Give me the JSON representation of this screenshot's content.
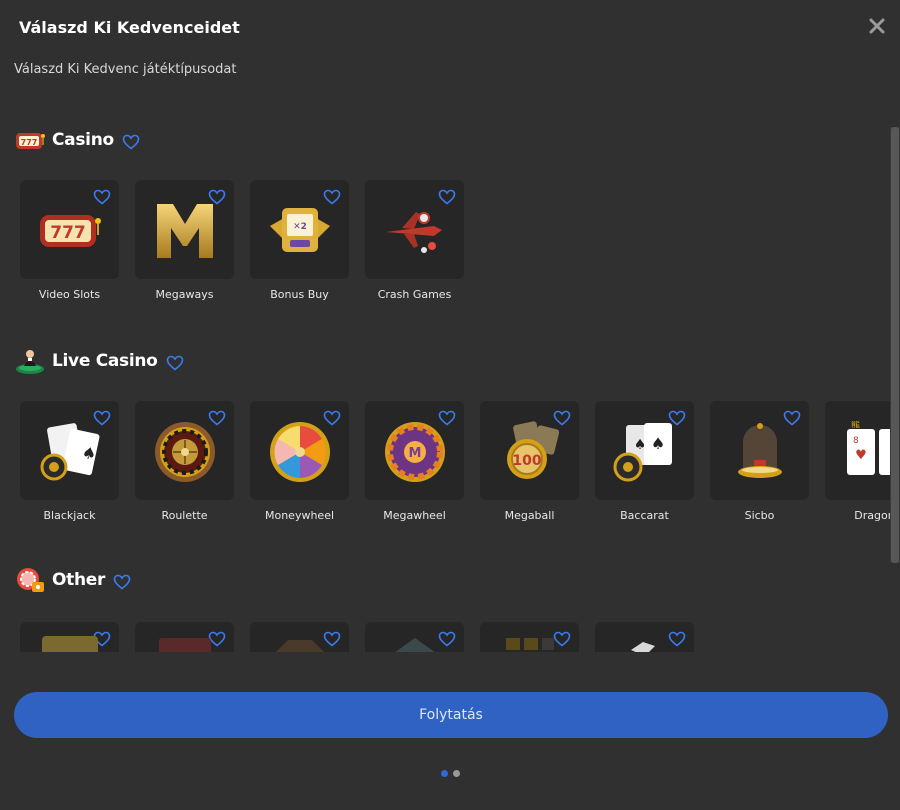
{
  "header": {
    "title": "Válaszd Ki Kedvenceidet",
    "subtitle": "Válaszd Ki Kedvenc játéktípusodat"
  },
  "sections": [
    {
      "title": "Casino",
      "icon": "slot-777-icon",
      "items": [
        {
          "label": "Video Slots",
          "icon": "slot-777-icon"
        },
        {
          "label": "Megaways",
          "icon": "gold-m-icon"
        },
        {
          "label": "Bonus Buy",
          "icon": "bonus-buy-icon"
        },
        {
          "label": "Crash Games",
          "icon": "plane-icon"
        }
      ]
    },
    {
      "title": "Live Casino",
      "icon": "dealer-icon",
      "items": [
        {
          "label": "Blackjack",
          "icon": "blackjack-cards-icon"
        },
        {
          "label": "Roulette",
          "icon": "roulette-wheel-icon"
        },
        {
          "label": "Moneywheel",
          "icon": "money-wheel-icon"
        },
        {
          "label": "Megawheel",
          "icon": "mega-wheel-icon"
        },
        {
          "label": "Megaball",
          "icon": "megaball-icon"
        },
        {
          "label": "Baccarat",
          "icon": "baccarat-cards-icon"
        },
        {
          "label": "Sicbo",
          "icon": "sicbo-dome-icon"
        },
        {
          "label": "Dragon",
          "icon": "dragon-cards-icon"
        }
      ]
    },
    {
      "title": "Other",
      "icon": "other-games-icon",
      "items": [
        {
          "label": "",
          "icon": "slot-icon"
        },
        {
          "label": "",
          "icon": "slot-reels-icon"
        },
        {
          "label": "",
          "icon": "table-icon"
        },
        {
          "label": "",
          "icon": "board-icon"
        },
        {
          "label": "",
          "icon": "bingo-icon"
        },
        {
          "label": "",
          "icon": "dice-icon"
        }
      ]
    }
  ],
  "footer": {
    "continue_label": "Folytatás",
    "pagination": {
      "total": 2,
      "active": 1
    }
  },
  "colors": {
    "background": "#303030",
    "tile": "#262626",
    "accent": "#2f62c2",
    "heart": "#3b7bf0"
  }
}
